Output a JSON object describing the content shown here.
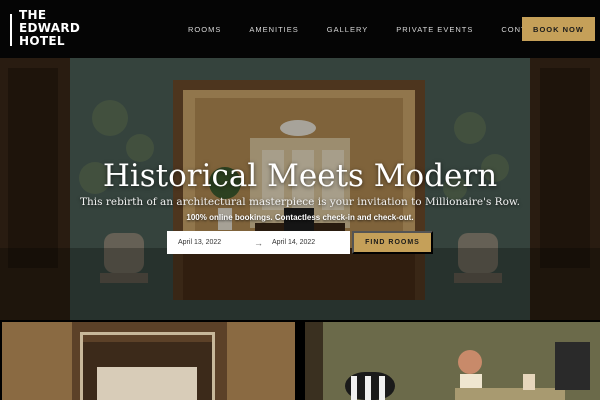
{
  "header": {
    "logo_lines": [
      "THE",
      "EDWARD",
      "HOTEL"
    ],
    "nav": [
      "ROOMS",
      "AMENITIES",
      "GALLERY",
      "PRIVATE EVENTS",
      "CONTACT US"
    ],
    "book_label": "BOOK NOW"
  },
  "hero": {
    "title": "Historical Meets Modern",
    "subtitle": "This rebirth of an architectural masterpiece is your invitation to Millionaire's Row.",
    "promo": "100% online bookings. Contactless check-in and check-out."
  },
  "booking": {
    "check_in": "April 13, 2022",
    "arrow": "→",
    "check_out": "April 14, 2022",
    "find_label": "FIND ROOMS"
  },
  "colors": {
    "accent": "#c5a059",
    "nav_bg": "#050505"
  },
  "icons": [
    "arrow-right-icon"
  ]
}
